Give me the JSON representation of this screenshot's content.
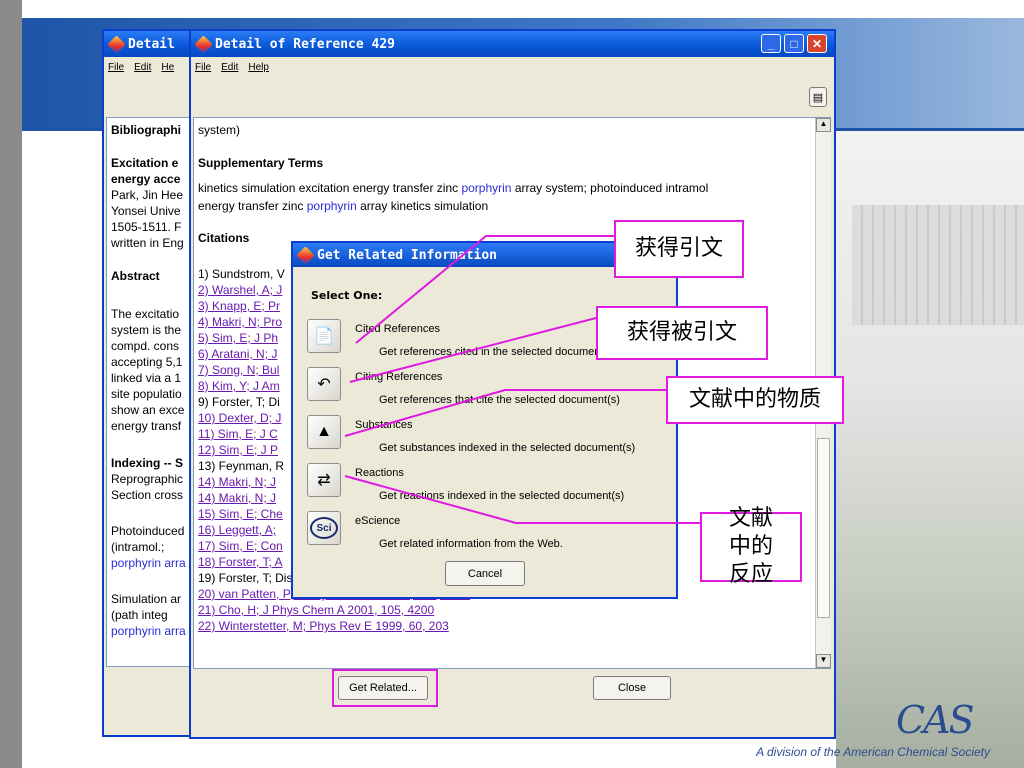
{
  "back_window": {
    "title": "Detail",
    "menu": [
      "File",
      "Edit",
      "He"
    ],
    "lines": [
      "Bibliographi",
      "Excitation e",
      "energy acce",
      "Park, Jin Hee",
      "Yonsei Unive",
      "1505-1511.  F",
      "written in Eng",
      "Abstract",
      "The excitatio",
      "system is the",
      "compd. cons",
      "accepting 5,1",
      "linked via a 1",
      "site populatio",
      "show an exce",
      "energy transf",
      "Indexing -- S",
      "Reprographic",
      "Section cross",
      "Photoinduced",
      "    (intramol.;",
      "porphyrin arra",
      "Simulation ar",
      "    (path integ",
      "porphyrin arra"
    ]
  },
  "main_window": {
    "title": "Detail of Reference 429",
    "menu": [
      "File",
      "Edit",
      "Help"
    ],
    "top_text": "system)",
    "supp_heading": "Supplementary Terms",
    "supp_line1_a": "kinetics simulation excitation energy transfer zinc ",
    "supp_line1_b": "porphyrin",
    "supp_line1_c": " array system; photoinduced intramol",
    "supp_line2_a": "energy transfer zinc ",
    "supp_line2_b": "porphyrin",
    "supp_line2_c": " array kinetics simulation",
    "citations_heading": "Citations",
    "citations": [
      {
        "text": "1) Sundstrom, V",
        "link": false
      },
      {
        "text": "2) Warshel, A; J",
        "link": true
      },
      {
        "text": "3) Knapp, E; Pr",
        "link": true
      },
      {
        "text": "4) Makri, N; Pro",
        "link": true
      },
      {
        "text": "5) Sim, E; J Ph",
        "link": true
      },
      {
        "text": "6) Aratani, N; J",
        "link": true
      },
      {
        "text": "7) Song, N; Bul",
        "link": true
      },
      {
        "text": "8) Kim, Y; J Am",
        "link": true
      },
      {
        "text": "9) Forster, T; Di",
        "link": false
      },
      {
        "text": "10) Dexter, D; J",
        "link": true
      },
      {
        "text": "11) Sim, E; J C",
        "link": true
      },
      {
        "text": "12) Sim, E; J P",
        "link": true
      },
      {
        "text": "13) Feynman, R",
        "link": false
      },
      {
        "text": "14) Makri, N; J",
        "link": true
      },
      {
        "text": "14) Makri, N; J",
        "link": true
      },
      {
        "text": "15) Sim, E; Che",
        "link": true
      },
      {
        "text": "16) Leggett, A;",
        "link": true
      },
      {
        "text": "17) Sim, E; Con",
        "link": true
      },
      {
        "text": "18) Forster, T; A",
        "link": true
      },
      {
        "text": "19) Forster, T; Discuss Faraday Soc 1959, 27, 7",
        "link": false
      },
      {
        "text": "20) van Patten, P; J Phys Chem B 1998, 102, 4209",
        "link": true
      },
      {
        "text": "21) Cho, H; J Phys Chem A 2001, 105, 4200",
        "link": true
      },
      {
        "text": "22) Winterstetter, M; Phys Rev E 1999, 60, 203",
        "link": true
      }
    ],
    "get_related_label": "Get Related...",
    "close_label": "Close"
  },
  "dialog": {
    "title": "Get Related Information",
    "prompt": "Select One:",
    "options": [
      {
        "name": "Cited References",
        "desc": "Get references cited in the selected document(s)",
        "icon": "cited-references-icon"
      },
      {
        "name": "Citing References",
        "desc": "Get references that cite the selected document(s)",
        "icon": "citing-references-icon"
      },
      {
        "name": "Substances",
        "desc": "Get substances indexed in the selected document(s)",
        "icon": "substances-icon"
      },
      {
        "name": "Reactions",
        "desc": "Get reactions indexed in the selected document(s)",
        "icon": "reactions-icon"
      },
      {
        "name": "eScience",
        "desc": "Get related information from the Web.",
        "icon": "escience-icon"
      }
    ],
    "cancel_label": "Cancel",
    "escience_badge": "Sci"
  },
  "callouts": {
    "get_citations": "获得引文",
    "get_cited_by": "获得被引文",
    "substances": "文献中的物质",
    "reactions": "文献中的反应"
  },
  "slide": {
    "footer": "A division of the American Chemical Society",
    "logo": "CAS"
  },
  "colors": {
    "accent_magenta": "#e01be0",
    "title_blue": "#0a5bdc",
    "link_purple": "#6a1ab0"
  }
}
